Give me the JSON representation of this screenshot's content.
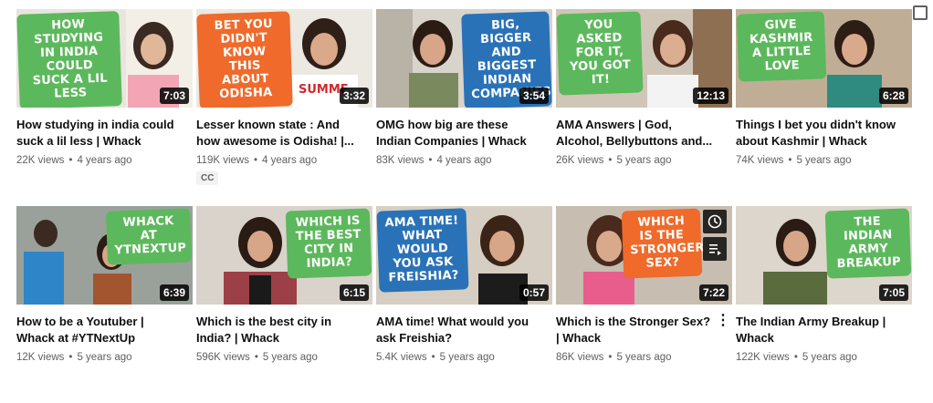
{
  "videos": [
    {
      "thumb_text": "How studying in India could suck a lil less",
      "duration": "7:03",
      "title": "How studying in india could suck a lil less | Whack",
      "views": "22K views",
      "age": "4 years ago"
    },
    {
      "thumb_text": "Bet you didn't know this about Odisha",
      "duration": "3:32",
      "title": "Lesser known state : And how awesome is Odisha! |...",
      "views": "119K views",
      "age": "4 years ago",
      "cc": "CC"
    },
    {
      "thumb_text": "Big, bigger and biggest Indian companies!",
      "duration": "3:54",
      "title": "OMG how big are these Indian Companies | Whack",
      "views": "83K views",
      "age": "4 years ago"
    },
    {
      "thumb_text": "You asked for it, you got it!",
      "duration": "12:13",
      "title": "AMA Answers | God, Alcohol, Bellybuttons and...",
      "views": "26K views",
      "age": "5 years ago"
    },
    {
      "thumb_text": "Give Kashmir a little love",
      "duration": "6:28",
      "title": "Things I bet you didn't know about Kashmir | Whack",
      "views": "74K views",
      "age": "5 years ago"
    },
    {
      "thumb_text": "Whack at YTNextUp",
      "duration": "6:39",
      "title": "How to be a Youtuber | Whack at #YTNextUp",
      "views": "12K views",
      "age": "5 years ago"
    },
    {
      "thumb_text": "Which is the best city in India?",
      "duration": "6:15",
      "title": "Which is the best city in India? | Whack",
      "views": "596K views",
      "age": "5 years ago"
    },
    {
      "thumb_text": "AMA time! What would you ask Freishia?",
      "duration": "0:57",
      "title": "AMA time! What would you ask Freishia?",
      "views": "5.4K views",
      "age": "5 years ago"
    },
    {
      "thumb_text": "Which is the stronger sex?",
      "duration": "7:22",
      "title": "Which is the Stronger Sex? | Whack",
      "views": "86K views",
      "age": "5 years ago"
    },
    {
      "thumb_text": "The Indian Army Breakup",
      "duration": "7:05",
      "title": "The Indian Army Breakup | Whack",
      "views": "122K views",
      "age": "5 years ago"
    }
  ],
  "meta_separator": "•",
  "more_icon": "⋮",
  "colors": {
    "green": "#5cb85c",
    "orange": "#ef6a2b",
    "blue": "#2a72b8",
    "meta_text": "#606060"
  }
}
